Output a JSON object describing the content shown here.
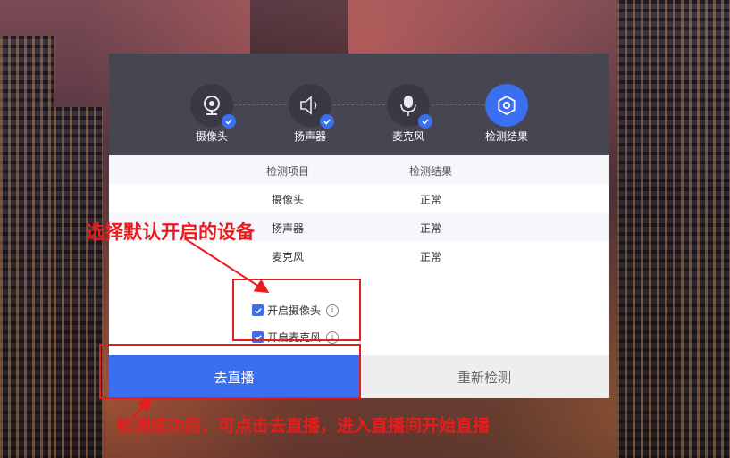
{
  "steps": [
    {
      "label": "摄像头",
      "icon": "webcam-icon",
      "status": "done"
    },
    {
      "label": "扬声器",
      "icon": "speaker-icon",
      "status": "done"
    },
    {
      "label": "麦克风",
      "icon": "microphone-icon",
      "status": "done"
    },
    {
      "label": "检测结果",
      "icon": "gear-icon",
      "status": "active"
    }
  ],
  "table": {
    "headers": [
      "检测项目",
      "检测结果"
    ],
    "rows": [
      [
        "摄像头",
        "正常"
      ],
      [
        "扬声器",
        "正常"
      ],
      [
        "麦克风",
        "正常"
      ]
    ]
  },
  "options": [
    {
      "label": "开启摄像头",
      "checked": true
    },
    {
      "label": "开启麦克风",
      "checked": true
    }
  ],
  "buttons": {
    "start_live": "去直播",
    "recheck": "重新检测"
  },
  "annotations": {
    "select_devices": "选择默认开启的设备",
    "go_live_hint": "检测成功后，可点击去直播，进入直播间开始直播"
  },
  "colors": {
    "accent": "#3a6ff0",
    "header_bg": "#484553",
    "annotation_red": "#e81c1c"
  }
}
